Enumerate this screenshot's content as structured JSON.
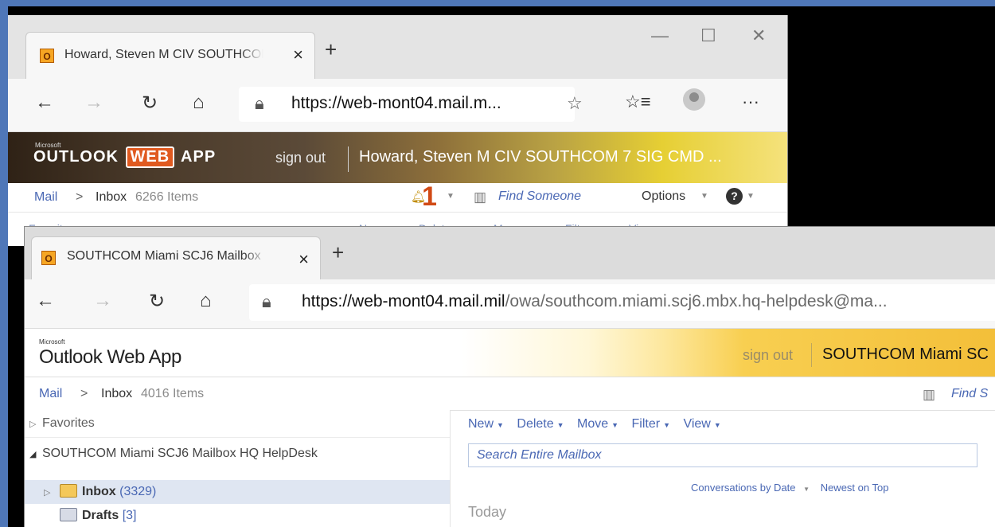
{
  "back_window": {
    "tab": {
      "title": "Howard, Steven M CIV SOUTHCOM",
      "close": "×",
      "new_tab": "+"
    },
    "window_controls": {
      "minimize": "—",
      "maximize": "☐",
      "close": "✕"
    },
    "address": {
      "url": "https://web-mont04.mail.m..."
    },
    "owa": {
      "microsoft_label": "Microsoft",
      "logo_left": "OUTLOOK ",
      "logo_badge": "WEB",
      "logo_right": " APP",
      "sign_out": "sign out",
      "user": "Howard, Steven M CIV SOUTHCOM 7 SIG CMD ..."
    },
    "breadcrumb": {
      "root": "Mail",
      "sep": ">",
      "folder": "Inbox",
      "count": "6266 Items"
    },
    "alerts": {
      "count": "1"
    },
    "find_someone": "Find Someone",
    "options": "Options",
    "help": "?",
    "cut_labels": [
      "Favorites",
      "New",
      "Delete",
      "Move",
      "Filter",
      "View"
    ]
  },
  "front_window": {
    "tab": {
      "title": "SOUTHCOM Miami SCJ6 Mailbox",
      "close": "×",
      "new_tab": "+"
    },
    "address": {
      "url_host": "https://web-mont04.mail.mil",
      "url_path": "/owa/southcom.miami.scj6.mbx.hq-helpdesk@ma..."
    },
    "owa": {
      "microsoft_label": "Microsoft",
      "logo": "Outlook Web App",
      "sign_out": "sign out",
      "user": "SOUTHCOM Miami SC"
    },
    "breadcrumb": {
      "root": "Mail",
      "sep": ">",
      "folder": "Inbox",
      "count": "4016 Items"
    },
    "find_someone": "Find S",
    "sidebar": {
      "favorites": "Favorites",
      "mailbox": "SOUTHCOM Miami SCJ6 Mailbox HQ HelpDesk",
      "folders": [
        {
          "name": "Inbox",
          "count": "(3329)"
        },
        {
          "name": "Drafts",
          "count": "[3]"
        }
      ]
    },
    "toolbar": {
      "new": "New",
      "delete": "Delete",
      "move": "Move",
      "filter": "Filter",
      "view": "View"
    },
    "search": {
      "placeholder": "Search Entire Mailbox"
    },
    "sort": {
      "arrange": "Conversations by Date",
      "order": "Newest on Top"
    },
    "group_header": "Today"
  },
  "nav_icons": [
    "back-arrow-icon",
    "forward-arrow-icon",
    "refresh-icon",
    "home-icon",
    "lock-icon",
    "favorite-star-icon",
    "favorites-list-icon",
    "profile-icon",
    "more-icon"
  ],
  "colors": {
    "link_blue": "#4a68b4",
    "owa_gold": "#f3bf39",
    "screen_border": "#4f77b8"
  }
}
